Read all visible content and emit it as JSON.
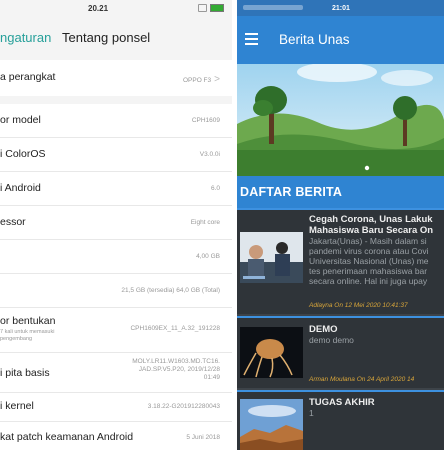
{
  "settings": {
    "status_time": "20.21",
    "back_label": "ngaturan",
    "title": "Tentang ponsel",
    "rows": [
      {
        "label": "a perangkat",
        "value": "OPPO F3"
      },
      {
        "label": "or model",
        "value": "CPH1609"
      },
      {
        "label": "i ColorOS",
        "value": "V3.0.0i"
      },
      {
        "label": "i Android",
        "value": "6.0"
      },
      {
        "label": "essor",
        "value": "Eight core"
      },
      {
        "label": "",
        "value": "4,00 GB"
      },
      {
        "label": "",
        "value": "21,5 GB (tersedia)   64,0 GB (Total)"
      },
      {
        "label": "or bentukan",
        "sub1": "7 kali untuk memasuki",
        "sub2": "pengembang",
        "value": "CPH1609EX_11_A.32_191228"
      },
      {
        "label": "i pita basis",
        "value1": "MOLY.LR11.W1603.MD.TC16.",
        "value2": "JAD.SP.V5.P20, 2019/12/28",
        "value3": "01:49"
      },
      {
        "label": "i kernel",
        "value": "3.18.22-G201912280043"
      },
      {
        "label": "kat patch keamanan Android",
        "value": "5 Juni 2018"
      }
    ]
  },
  "news_app": {
    "status_time": "21:01",
    "title": "Berita Unas",
    "section_title": "DAFTAR BERITA",
    "colors": {
      "primary": "#2f84d2",
      "list_bg": "#2f3439",
      "meta": "#d9a63a"
    },
    "items": [
      {
        "title1": "Cegah Corona, Unas Lakuk",
        "title2": "Mahasiswa Baru Secara On",
        "body1": "Jakarta(Unas) - Masih dalam si",
        "body2": "pandemi virus corona atau Covi",
        "body3": "Universitas Nasional (Unas) me",
        "body4": "tes penerimaan mahasiswa bar",
        "body5": "secara online. Hal ini juga upay",
        "meta": "Adlayna On 12 Mei 2020 10:41:37"
      },
      {
        "title1": "DEMO",
        "body1": "demo demo",
        "meta": "Arman Moulana On 24 April 2020 14"
      },
      {
        "title1": "TUGAS AKHIR",
        "body1": "1"
      }
    ]
  }
}
